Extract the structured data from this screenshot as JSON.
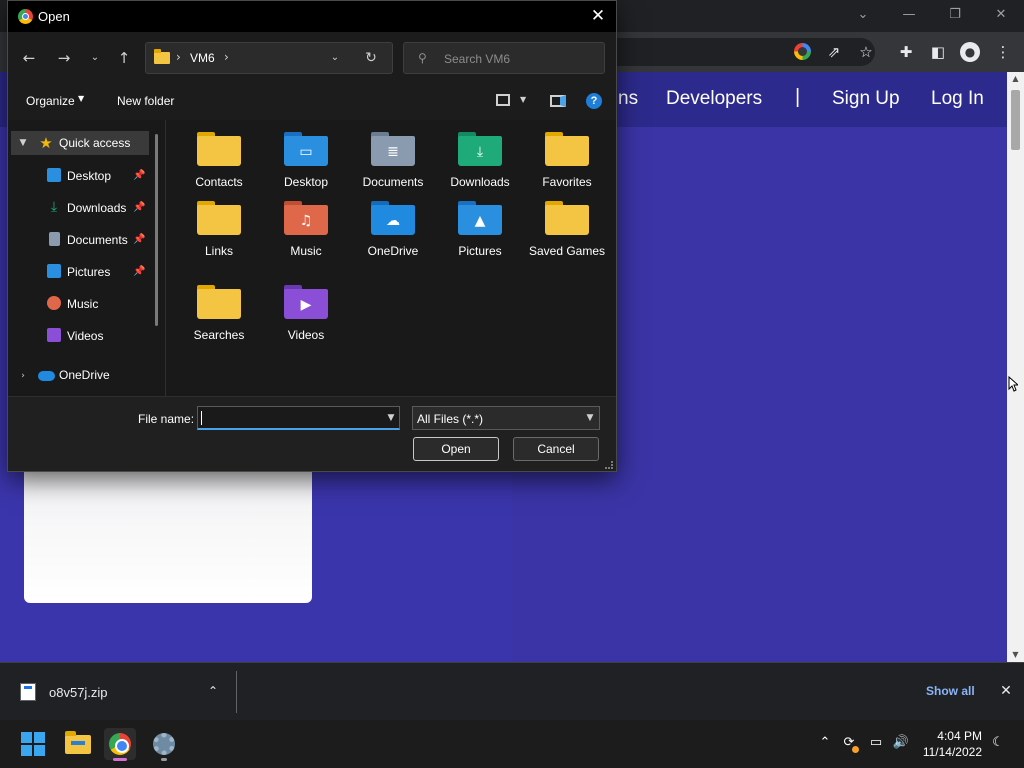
{
  "dialog": {
    "title": "Open",
    "address": "VM6",
    "search_placeholder": "Search VM6",
    "commands": {
      "organize": "Organize",
      "new_folder": "New folder",
      "help": "?"
    },
    "nav": {
      "quick_access": "Quick access",
      "items": [
        {
          "label": "Desktop",
          "icon": "desktop-icon",
          "pinned": true
        },
        {
          "label": "Downloads",
          "icon": "download-arrow-icon",
          "pinned": true
        },
        {
          "label": "Documents",
          "icon": "document-icon",
          "pinned": true
        },
        {
          "label": "Pictures",
          "icon": "picture-icon",
          "pinned": true
        },
        {
          "label": "Music",
          "icon": "music-note-icon",
          "pinned": false
        },
        {
          "label": "Videos",
          "icon": "video-icon",
          "pinned": false
        }
      ],
      "onedrive": "OneDrive"
    },
    "folders": [
      {
        "label": "Contacts",
        "icon": "folder-icon",
        "color": "#f4c542"
      },
      {
        "label": "Desktop",
        "icon": "desktop-folder-icon",
        "color": "#2b8fe0"
      },
      {
        "label": "Documents",
        "icon": "documents-folder-icon",
        "color": "#8a9bb0"
      },
      {
        "label": "Downloads",
        "icon": "downloads-folder-icon",
        "color": "#1faa7a"
      },
      {
        "label": "Favorites",
        "icon": "folder-icon",
        "color": "#f4c542"
      },
      {
        "label": "Links",
        "icon": "folder-icon",
        "color": "#f4c542"
      },
      {
        "label": "Music",
        "icon": "music-folder-icon",
        "color": "#e0684a"
      },
      {
        "label": "OneDrive",
        "icon": "onedrive-folder-icon",
        "color": "#1f8ae0"
      },
      {
        "label": "Pictures",
        "icon": "pictures-folder-icon",
        "color": "#2b8fe0"
      },
      {
        "label": "Saved Games",
        "icon": "folder-icon",
        "color": "#f4c542"
      },
      {
        "label": "Searches",
        "icon": "folder-icon",
        "color": "#f4c542"
      },
      {
        "label": "Videos",
        "icon": "videos-folder-icon",
        "color": "#8a4fd6"
      }
    ],
    "file_name_label": "File name:",
    "file_name_value": "",
    "file_type": "All Files (*.*)",
    "open_button": "Open",
    "cancel_button": "Cancel"
  },
  "webpage": {
    "nav_partial": "ns",
    "nav_developers": "Developers",
    "nav_separator": "|",
    "nav_signup": "Sign Up",
    "nav_login": "Log In",
    "background_color": "#3c35a8"
  },
  "download_shelf": {
    "file_name": "o8v57j.zip",
    "show_all": "Show all"
  },
  "taskbar": {
    "time": "4:04 PM",
    "date": "11/14/2022"
  }
}
